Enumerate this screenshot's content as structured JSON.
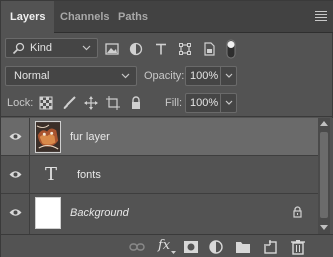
{
  "tabs": [
    {
      "label": "Layers",
      "active": true
    },
    {
      "label": "Channels",
      "active": false
    },
    {
      "label": "Paths",
      "active": false
    }
  ],
  "filter": {
    "kind_label": "Kind",
    "icons": [
      "image-filter-icon",
      "adjustment-filter-icon",
      "type-filter-icon",
      "shape-filter-icon",
      "smart-object-filter-icon",
      "filter-toggle-icon"
    ]
  },
  "blend": {
    "mode": "Normal",
    "opacity_label": "Opacity:",
    "opacity_value": "100%"
  },
  "lock": {
    "label": "Lock:",
    "fill_label": "Fill:",
    "fill_value": "100%",
    "icons": [
      "lock-transparent-pixels-icon",
      "lock-image-pixels-icon",
      "lock-position-icon",
      "artboard-lock-icon",
      "lock-all-icon"
    ]
  },
  "layers": [
    {
      "name": "fur layer",
      "type": "image",
      "visible": true,
      "selected": true,
      "italic": false
    },
    {
      "name": "fonts",
      "type": "text",
      "visible": true,
      "selected": false,
      "italic": false
    },
    {
      "name": "Background",
      "type": "background",
      "visible": true,
      "selected": false,
      "italic": true,
      "locked": true
    }
  ],
  "footer": {
    "icons": [
      "link-layers-icon",
      "fx-icon",
      "add-mask-icon",
      "adjustment-layer-icon",
      "group-folder-icon",
      "new-layer-icon",
      "trash-icon"
    ],
    "fx_label": "fx"
  },
  "colors": {
    "panel_bg": "#535353",
    "tabbar_bg": "#424242",
    "selected_row": "#6a6a6a",
    "text": "#d6d6d6"
  }
}
